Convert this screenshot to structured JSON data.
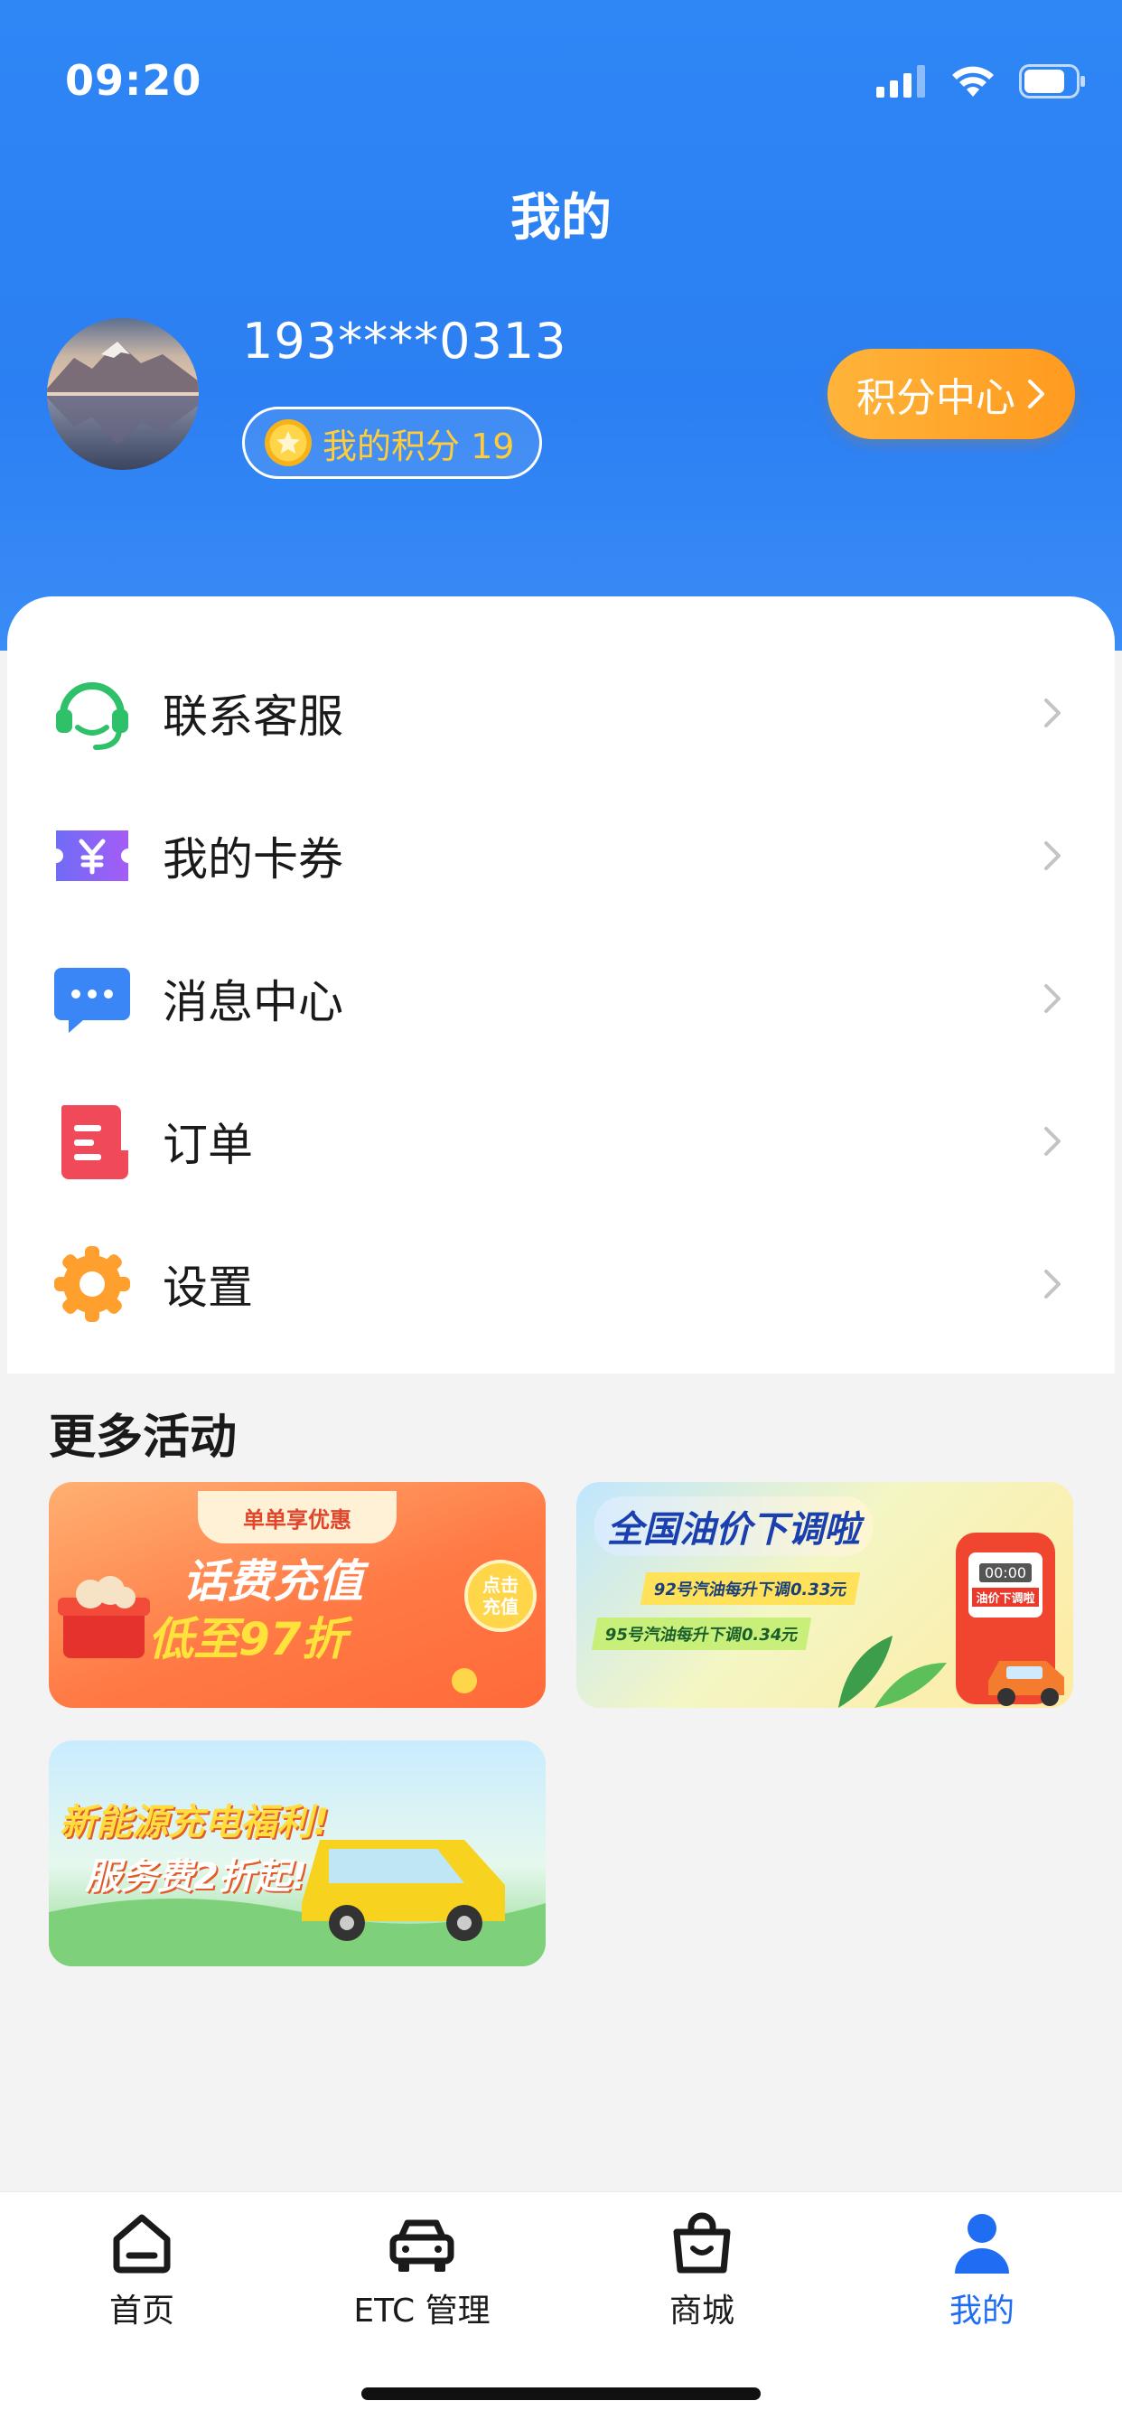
{
  "status_bar": {
    "time": "09:20"
  },
  "page_title": "我的",
  "profile": {
    "phone": "193****0313",
    "points_label": "我的积分 19",
    "points_center_label": "积分中心"
  },
  "menu": [
    {
      "label": "联系客服",
      "icon": "headset-icon",
      "color": "#2fc06a"
    },
    {
      "label": "我的卡券",
      "icon": "coupon-icon",
      "color": "#8a5cf6"
    },
    {
      "label": "消息中心",
      "icon": "message-icon",
      "color": "#3a86f7"
    },
    {
      "label": "订单",
      "icon": "order-icon",
      "color": "#f04a5a"
    },
    {
      "label": "设置",
      "icon": "gear-icon",
      "color": "#ff9f2e"
    }
  ],
  "section_title": "更多活动",
  "promos": {
    "phone_recharge": {
      "tag": "单单享优惠",
      "line1": "话费充值",
      "line2": "低至97折",
      "button": "点击充值"
    },
    "fuel_price": {
      "title": "全国油价下调啦",
      "line1": "92号汽油每升下调0.33元",
      "line2": "95号汽油每升下调0.34元",
      "pump_display": "00:00",
      "pump_label": "油价下调啦"
    },
    "ev_charging": {
      "line1": "新能源充电福利!",
      "line2": "服务费2折起!"
    }
  },
  "tabs": [
    {
      "label": "首页",
      "icon": "home-icon"
    },
    {
      "label": "ETC 管理",
      "icon": "car-icon"
    },
    {
      "label": "商城",
      "icon": "shopping-bag-icon"
    },
    {
      "label": "我的",
      "icon": "profile-icon",
      "active": true
    }
  ],
  "colors": {
    "brand_blue": "#2f86f5",
    "accent_orange": "#ff9a1f",
    "active_tab": "#1f6df2"
  }
}
